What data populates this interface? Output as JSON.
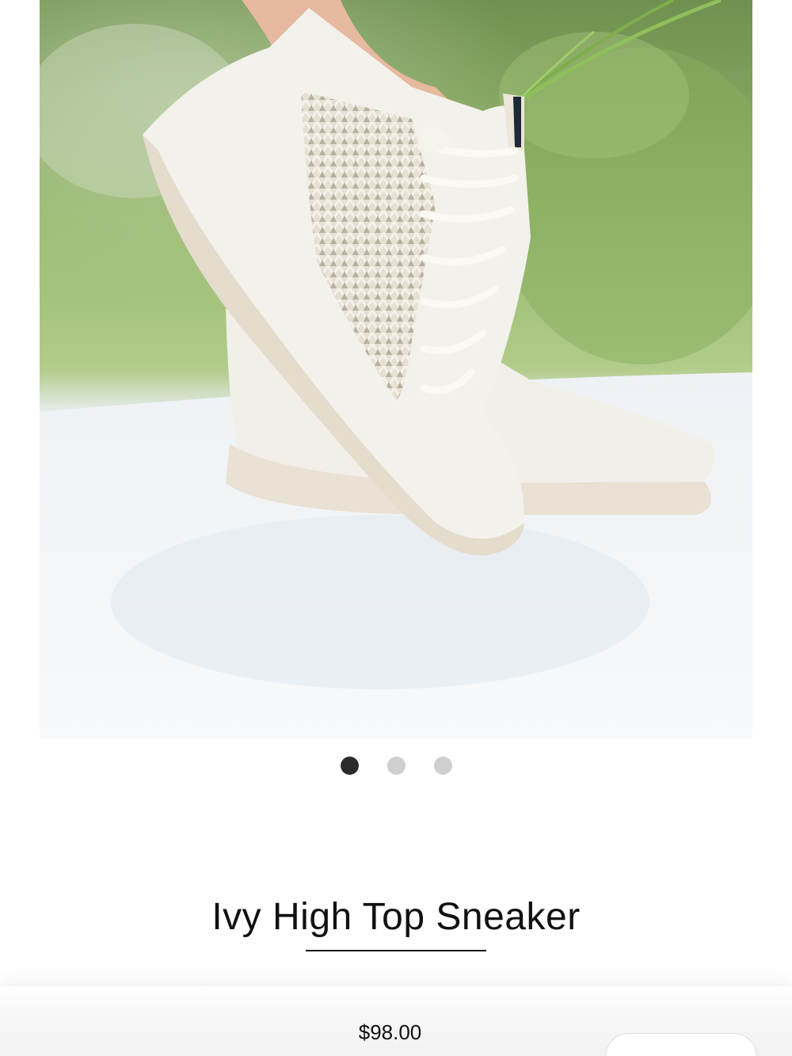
{
  "product": {
    "title": "Ivy High Top Sneaker",
    "price": "$98.00",
    "image": {
      "alt": "White woven high top sneaker worn on a foot",
      "background_color": "#9bbf72",
      "shoe_color": "#f1eee6"
    }
  },
  "carousel": {
    "dot_count": 3,
    "active_index": 0
  },
  "colors": {
    "text": "#111111",
    "dot_active": "#2b2b2b",
    "dot_inactive": "#cfcfcf"
  }
}
